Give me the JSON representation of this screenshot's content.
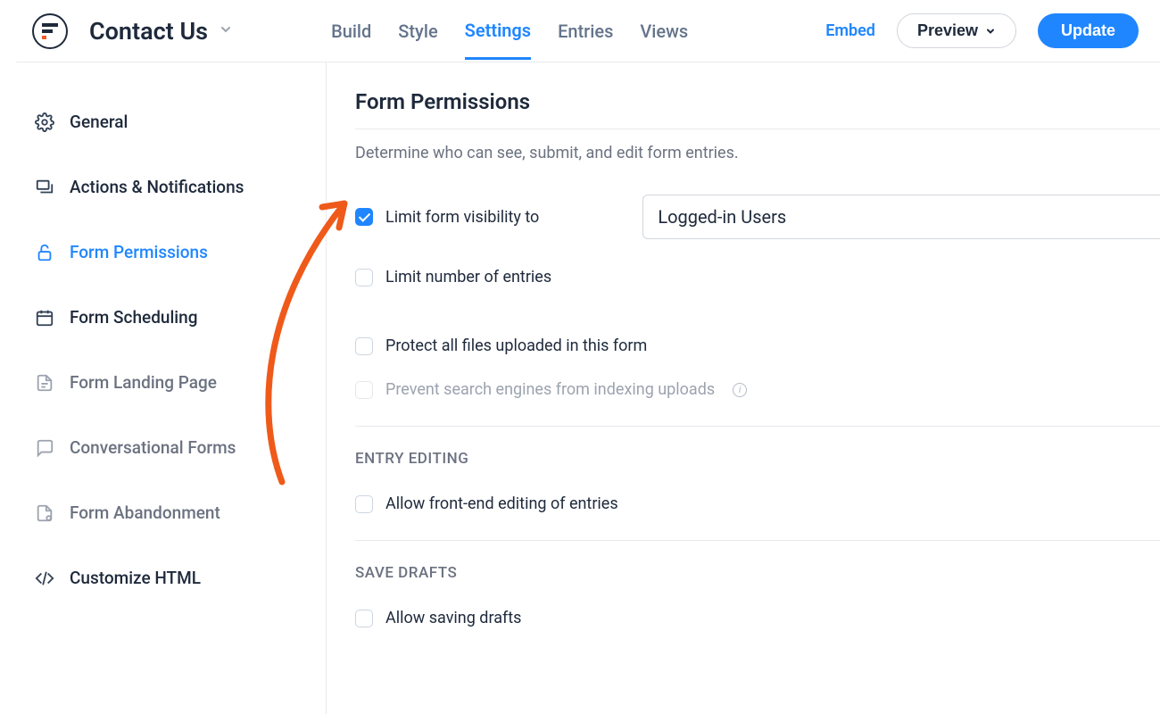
{
  "header": {
    "form_title": "Contact Us",
    "tabs": {
      "build": "Build",
      "style": "Style",
      "settings": "Settings",
      "entries": "Entries",
      "views": "Views"
    },
    "embed": "Embed",
    "preview": "Preview",
    "update": "Update"
  },
  "sidebar": {
    "general": "General",
    "actions": "Actions & Notifications",
    "permissions": "Form Permissions",
    "scheduling": "Form Scheduling",
    "landing": "Form Landing Page",
    "conversational": "Conversational Forms",
    "abandonment": "Form Abandonment",
    "customize_html": "Customize HTML"
  },
  "panel": {
    "title": "Form Permissions",
    "desc": "Determine who can see, submit, and edit form entries.",
    "limit_visibility": "Limit form visibility to",
    "visibility_value": "Logged-in Users",
    "limit_entries": "Limit number of entries",
    "protect_files": "Protect all files uploaded in this form",
    "prevent_indexing": "Prevent search engines from indexing uploads",
    "entry_editing_head": "ENTRY EDITING",
    "allow_front_end": "Allow front-end editing of entries",
    "save_drafts_head": "SAVE DRAFTS",
    "allow_drafts": "Allow saving drafts"
  }
}
